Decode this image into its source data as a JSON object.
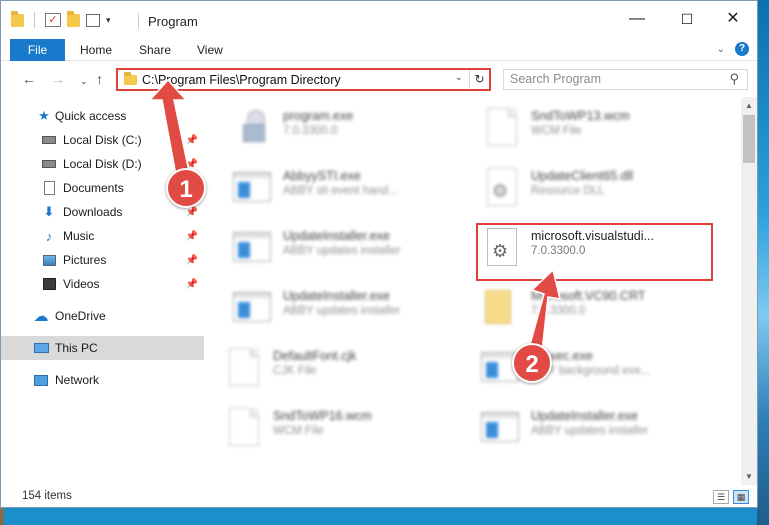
{
  "window": {
    "title": "Program",
    "minimize_glyph": "—",
    "maximize_glyph": "☐",
    "close_glyph": "✕"
  },
  "ribbon": {
    "tabs": [
      "File",
      "Home",
      "Share",
      "View"
    ],
    "help": "?"
  },
  "address": {
    "path": "C:\\Program Files\\Program Directory",
    "search_placeholder": "Search Program"
  },
  "nav": {
    "items": [
      {
        "label": "Quick access",
        "icon": "star-icon",
        "pinned": false
      },
      {
        "label": "Local Disk (C:)",
        "icon": "drive-icon",
        "pinned": true
      },
      {
        "label": "Local Disk (D:)",
        "icon": "drive-icon",
        "pinned": true
      },
      {
        "label": "Documents",
        "icon": "documents-icon",
        "pinned": true
      },
      {
        "label": "Downloads",
        "icon": "download-icon",
        "pinned": true
      },
      {
        "label": "Music",
        "icon": "music-icon",
        "pinned": true
      },
      {
        "label": "Pictures",
        "icon": "pictures-icon",
        "pinned": true
      },
      {
        "label": "Videos",
        "icon": "videos-icon",
        "pinned": true
      },
      {
        "label": "OneDrive",
        "icon": "cloud-icon",
        "pinned": false
      },
      {
        "label": "This PC",
        "icon": "computer-icon",
        "pinned": false,
        "selected": true
      },
      {
        "label": "Network",
        "icon": "network-icon",
        "pinned": false
      }
    ]
  },
  "files": [
    {
      "name": "program.exe",
      "desc": "7.0.3300.0",
      "icon": "setup-icon"
    },
    {
      "name": "SndToWP13.wcm",
      "desc": "WCM File",
      "icon": "document-icon"
    },
    {
      "name": "AbbyySTI.exe",
      "desc": "ABBY sti event hand...",
      "icon": "application-icon"
    },
    {
      "name": "UpdateClient65.dll",
      "desc": "Resource DLL",
      "icon": "dll-icon"
    },
    {
      "name": "UpdateInstaller.exe",
      "desc": "ABBY updates installer",
      "icon": "application-icon"
    },
    {
      "name": "microsoft.visualstudi...",
      "desc": "7.0.3300.0",
      "icon": "dll-icon",
      "highlighted": true
    },
    {
      "name": "UpdateInstaller.exe",
      "desc": "ABBY updates installer",
      "icon": "application-icon"
    },
    {
      "name": "Microsoft.VC90.CRT",
      "desc": "7.0.3300.0",
      "icon": "folder-doc-icon"
    },
    {
      "name": "DefaultFont.cjk",
      "desc": "CJK File",
      "icon": "document-icon"
    },
    {
      "name": "...Exec.exe",
      "desc": "...BY background eve...",
      "icon": "application-icon"
    },
    {
      "name": "SndToWP16.wcm",
      "desc": "WCM File",
      "icon": "document-icon"
    },
    {
      "name": "UpdateInstaller.exe",
      "desc": "ABBY updates installer",
      "icon": "application-icon"
    }
  ],
  "status": {
    "items_count": "154 items"
  },
  "annotations": {
    "marker1": "1",
    "marker2": "2",
    "color": "#e24a44"
  }
}
